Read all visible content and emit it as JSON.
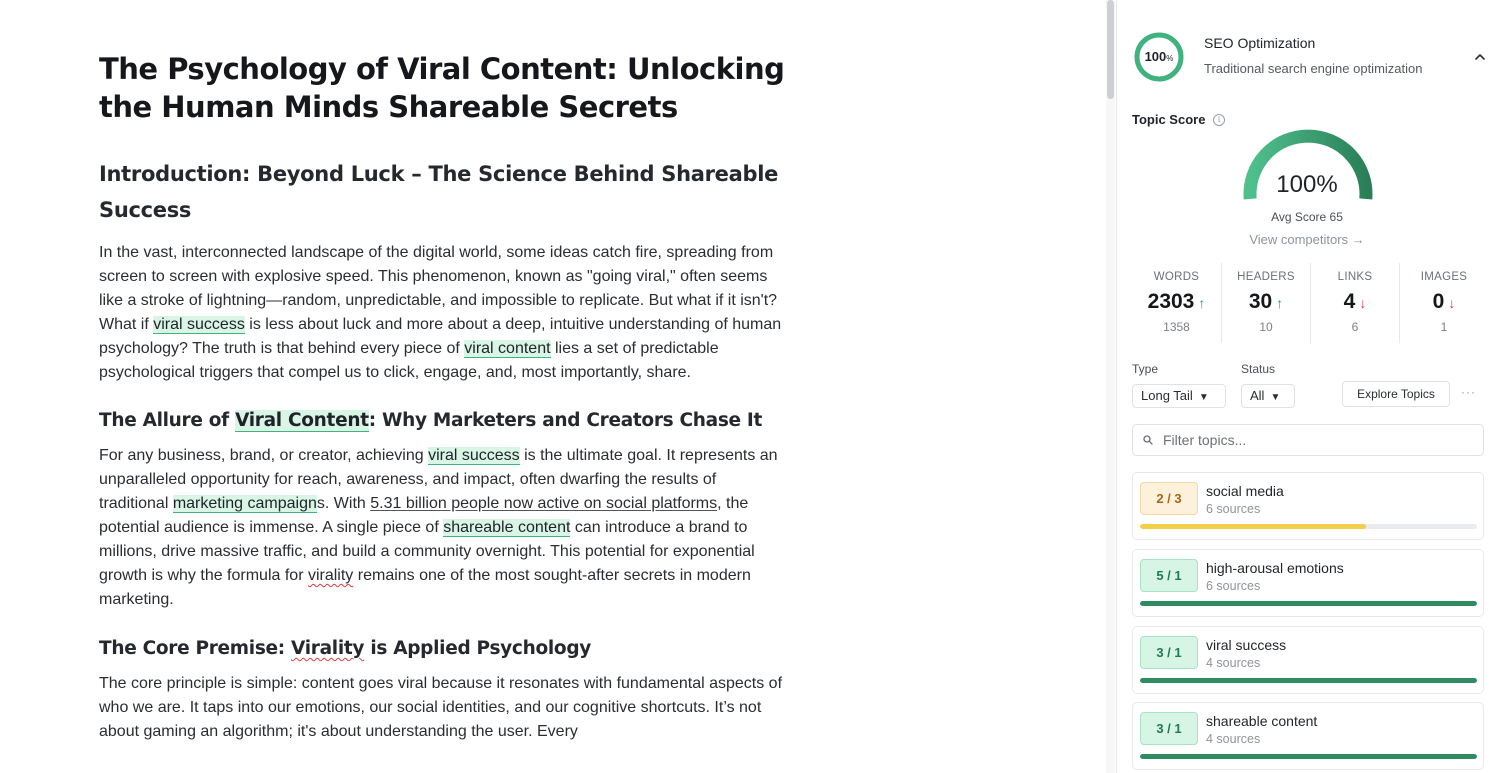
{
  "document": {
    "title": "The Psychology of Viral Content: Unlocking the Human Minds Shareable Secrets",
    "intro_heading": "Introduction: Beyond Luck – The Science Behind Shareable Success",
    "intro_p": {
      "t1": "In the vast, interconnected landscape of the digital world, some ideas catch fire, spreading from screen to screen with explosive speed. This phenomenon, known as \"going viral,\" often seems like a stroke of lightning—random, unpredictable, and impossible to replicate. But what if it isn't? What if ",
      "k1": "viral success",
      "t2": " is less about luck and more about a deep, intuitive understanding of human psychology? The truth is that behind every piece of ",
      "k2": "viral content",
      "t3": " lies a set of predictable psychological triggers that compel us to click, engage, and, most importantly, share."
    },
    "allure_heading": {
      "t1": "The Allure of ",
      "k1": "Viral Content",
      "t2": ": Why Marketers and Creators Chase It"
    },
    "allure_p": {
      "t1": "For any business, brand, or creator, achieving ",
      "k1": "viral success",
      "t2": " is the ultimate goal. It represents an unparalleled opportunity for reach, awareness, and impact, often dwarfing the results of traditional ",
      "k2": "marketing campaign",
      "t3": "s. With ",
      "link": "5.31 billion people now active on social platforms",
      "t4": ", the potential audience is immense. A single piece of ",
      "k3": "shareable content",
      "t5": " can introduce a brand to millions, drive massive traffic, and build a community overnight. This potential for exponential growth is why the formula for ",
      "sq": "virality",
      "t6": " remains one of the most sought-after secrets in modern marketing."
    },
    "core_heading": {
      "t1": "The Core Premise: ",
      "sq": "Virality",
      "t2": " is Applied Psychology"
    },
    "core_p": "The core principle is simple: content goes viral because it resonates with fundamental aspects of who we are. It taps into our emotions, our social identities, and our cognitive shortcuts. It’s not about gaming an algorithm; it's about understanding the user. Every"
  },
  "panel": {
    "seo": {
      "score": "100",
      "score_unit": "%",
      "title": "SEO Optimization",
      "subtitle": "Traditional search engine optimization"
    },
    "topic_score": {
      "label": "Topic Score",
      "value": "100%",
      "gauge_fraction": 1.0,
      "avg": "Avg Score 65",
      "view_competitors": "View competitors →"
    },
    "stats": [
      {
        "label": "WORDS",
        "value": "2303",
        "trend": "↑",
        "compare": "1358"
      },
      {
        "label": "HEADERS",
        "value": "30",
        "trend": "↑",
        "compare": "10"
      },
      {
        "label": "LINKS",
        "value": "4",
        "trend": "↓",
        "compare": "6"
      },
      {
        "label": "IMAGES",
        "value": "0",
        "trend": "↓",
        "compare": "1"
      }
    ],
    "filters": {
      "type_label": "Type",
      "type_value": "Long Tail",
      "status_label": "Status",
      "status_value": "All",
      "explore_button": "Explore Topics",
      "more": "···",
      "search_placeholder": "Filter topics..."
    },
    "topics": [
      {
        "badge": "2 / 3",
        "name": "social media",
        "sources": "6 sources",
        "progress": 0.67,
        "state": "warn"
      },
      {
        "badge": "5 / 1",
        "name": "high-arousal emotions",
        "sources": "6 sources",
        "progress": 1.0,
        "state": "good"
      },
      {
        "badge": "3 / 1",
        "name": "viral success",
        "sources": "4 sources",
        "progress": 1.0,
        "state": "good"
      },
      {
        "badge": "3 / 1",
        "name": "shareable content",
        "sources": "4 sources",
        "progress": 1.0,
        "state": "good"
      }
    ],
    "colors": {
      "good": "#2e8b62",
      "warn": "#f2cf4a",
      "accent": "#3fb27f"
    }
  }
}
